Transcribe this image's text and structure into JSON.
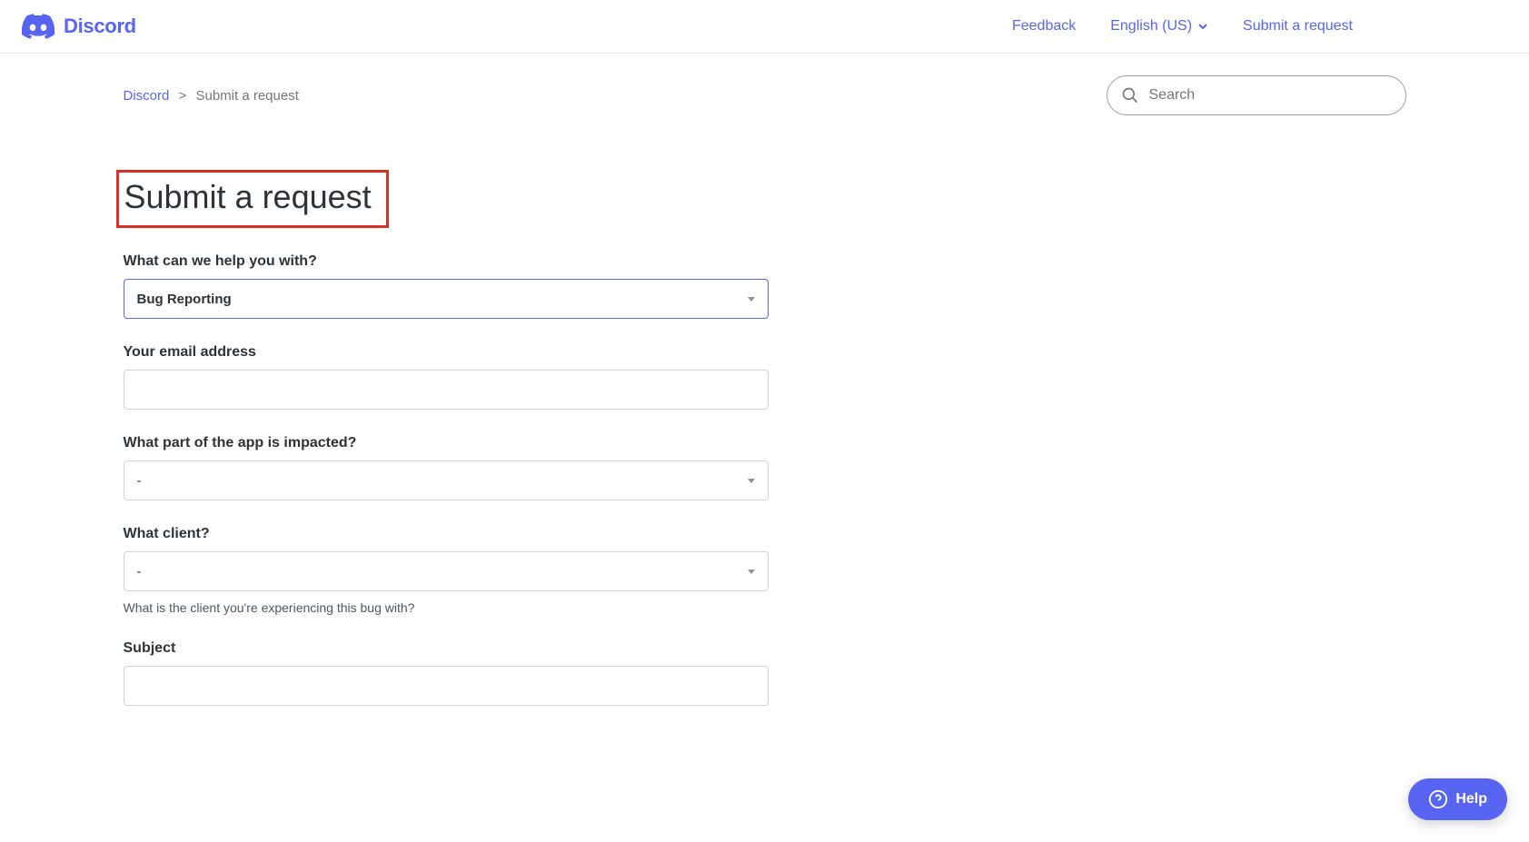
{
  "header": {
    "logo_text": "Discord",
    "nav": {
      "feedback": "Feedback",
      "language": "English (US)",
      "submit": "Submit a request"
    }
  },
  "breadcrumb": {
    "root": "Discord",
    "current": "Submit a request"
  },
  "search": {
    "placeholder": "Search"
  },
  "page": {
    "title": "Submit a request"
  },
  "form": {
    "help_with": {
      "label": "What can we help you with?",
      "value": "Bug Reporting"
    },
    "email": {
      "label": "Your email address",
      "value": ""
    },
    "part_impacted": {
      "label": "What part of the app is impacted?",
      "value": "-"
    },
    "client": {
      "label": "What client?",
      "value": "-",
      "hint": "What is the client you're experiencing this bug with?"
    },
    "subject": {
      "label": "Subject",
      "value": ""
    }
  },
  "help_widget": {
    "label": "Help"
  }
}
